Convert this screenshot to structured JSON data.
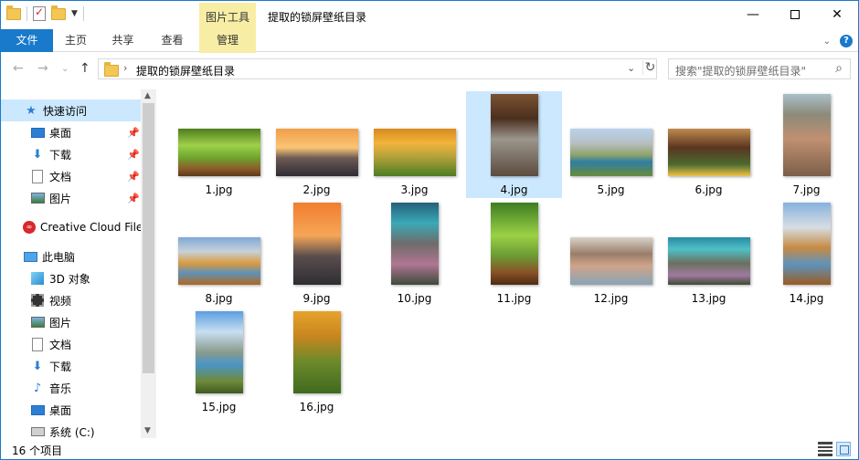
{
  "window": {
    "title": "提取的锁屏壁纸目录",
    "context_tab_label": "图片工具"
  },
  "ribbon": {
    "tabs": [
      "文件",
      "主页",
      "共享",
      "查看",
      "管理"
    ]
  },
  "address": {
    "path": "提取的锁屏壁纸目录",
    "search_placeholder": "搜索\"提取的锁屏壁纸目录\""
  },
  "nav_pane": {
    "items": [
      {
        "label": "快速访问",
        "icon": "star-icon"
      },
      {
        "label": "桌面",
        "icon": "desktop-icon",
        "pinned": true
      },
      {
        "label": "下载",
        "icon": "download-icon",
        "pinned": true
      },
      {
        "label": "文档",
        "icon": "document-icon",
        "pinned": true
      },
      {
        "label": "图片",
        "icon": "picture-icon",
        "pinned": true
      },
      {
        "label": "Creative Cloud File",
        "icon": "creative-cloud-icon"
      },
      {
        "label": "此电脑",
        "icon": "this-pc-icon"
      },
      {
        "label": "3D 对象",
        "icon": "3d-objects-icon"
      },
      {
        "label": "视频",
        "icon": "video-icon"
      },
      {
        "label": "图片",
        "icon": "picture-icon"
      },
      {
        "label": "文档",
        "icon": "document-icon"
      },
      {
        "label": "下载",
        "icon": "download-icon"
      },
      {
        "label": "音乐",
        "icon": "music-icon"
      },
      {
        "label": "桌面",
        "icon": "desktop-icon"
      },
      {
        "label": "系统 (C:)",
        "icon": "drive-icon"
      }
    ]
  },
  "files": [
    {
      "name": "1.jpg",
      "orientation": "landscape"
    },
    {
      "name": "2.jpg",
      "orientation": "landscape"
    },
    {
      "name": "3.jpg",
      "orientation": "landscape"
    },
    {
      "name": "4.jpg",
      "orientation": "portrait",
      "selected": true
    },
    {
      "name": "5.jpg",
      "orientation": "landscape"
    },
    {
      "name": "6.jpg",
      "orientation": "landscape"
    },
    {
      "name": "7.jpg",
      "orientation": "portrait"
    },
    {
      "name": "8.jpg",
      "orientation": "landscape"
    },
    {
      "name": "9.jpg",
      "orientation": "portrait"
    },
    {
      "name": "10.jpg",
      "orientation": "portrait"
    },
    {
      "name": "11.jpg",
      "orientation": "portrait"
    },
    {
      "name": "12.jpg",
      "orientation": "landscape"
    },
    {
      "name": "13.jpg",
      "orientation": "landscape"
    },
    {
      "name": "14.jpg",
      "orientation": "portrait"
    },
    {
      "name": "15.jpg",
      "orientation": "portrait"
    },
    {
      "name": "16.jpg",
      "orientation": "portrait"
    }
  ],
  "status": {
    "item_count": "16 个项目"
  },
  "colors": {
    "accent": "#1979ca",
    "context_tab": "#f7eda4",
    "selection": "#cce8ff"
  }
}
